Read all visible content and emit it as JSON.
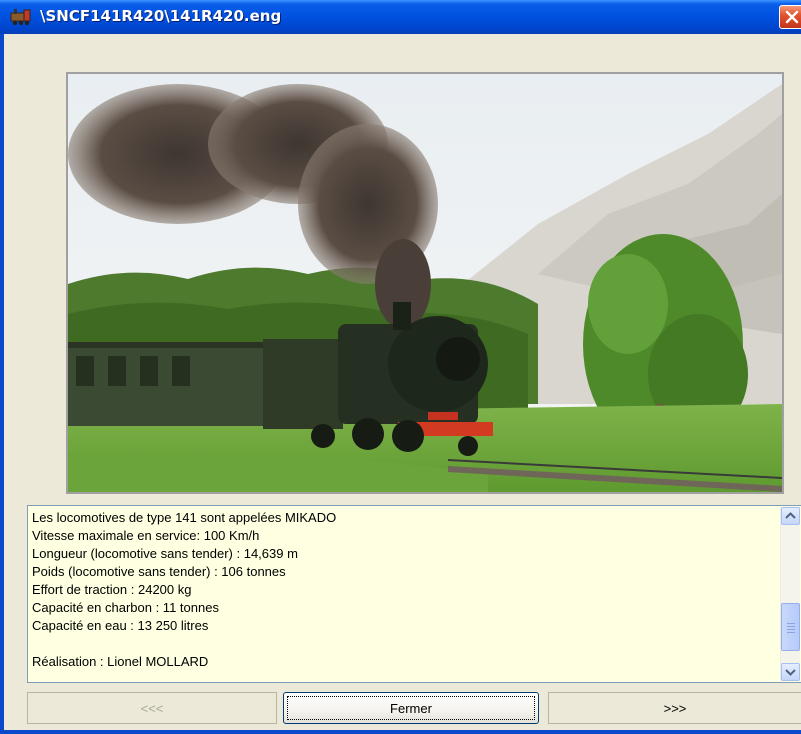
{
  "window": {
    "title": "\\SNCF141R420\\141R420.eng",
    "title_icon": "locomotive-icon",
    "close_icon": "close-icon"
  },
  "photo": {
    "description_icon": "steam-locomotive-photo"
  },
  "description": {
    "lines": [
      "Les locomotives de type 141 sont appelées MIKADO",
      "Vitesse maximale en service: 100 Km/h",
      "Longueur (locomotive sans tender) : 14,639 m",
      "Poids (locomotive sans tender) : 106 tonnes",
      "Effort de traction : 24200 kg",
      "Capacité en charbon : 11 tonnes",
      "Capacité en eau : 13 250 litres",
      "",
      "Réalisation : Lionel MOLLARD"
    ]
  },
  "buttons": {
    "prev_label": "<<<",
    "close_label": "Fermer",
    "next_label": ">>>"
  },
  "colors": {
    "title_bar": "#0051e0",
    "textbox_bg": "#ffffe1",
    "close_button": "#e2532d"
  }
}
